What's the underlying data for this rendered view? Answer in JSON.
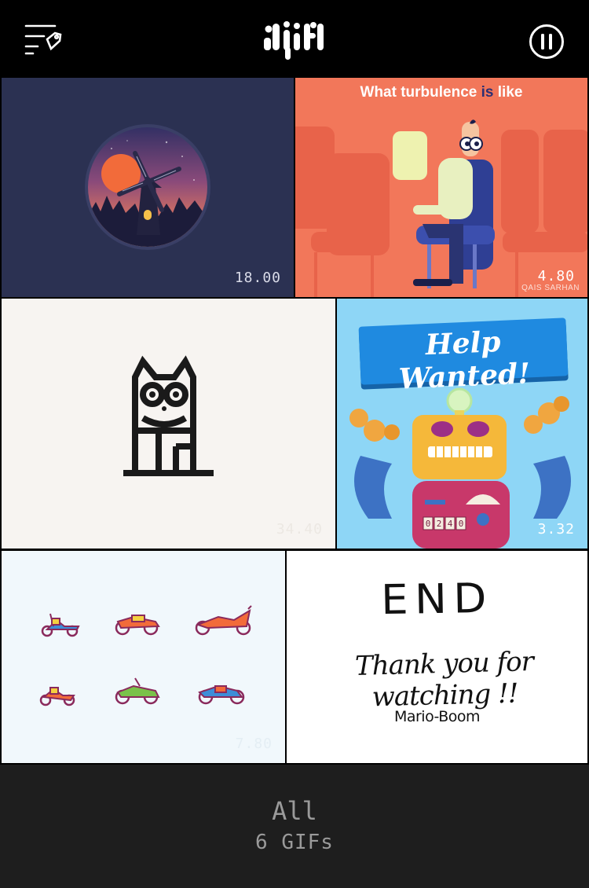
{
  "header": {
    "logo_text": "djif",
    "menu_icon": "menu-tag-icon",
    "pause_icon": "pause-circle-icon"
  },
  "gifs": [
    {
      "id": "windmill",
      "duration": "18.00",
      "duration_color": "#d9dbe8"
    },
    {
      "id": "turbulence",
      "title_pre": "What turbulence ",
      "title_hl": "is",
      "title_post": " like",
      "duration": "4.80",
      "credit": "QAIS SARHAN",
      "duration_color": "#ffffff"
    },
    {
      "id": "cat",
      "duration": "34.40",
      "duration_color": "#ece8e3"
    },
    {
      "id": "help-wanted",
      "banner": "Help Wanted!",
      "counter": [
        "0",
        "2",
        "4",
        "0"
      ],
      "duration": "3.32",
      "duration_color": "#ffffff"
    },
    {
      "id": "motorbikes",
      "duration": "7.80",
      "duration_color": "#e4eef4"
    },
    {
      "id": "end",
      "heading": "END",
      "message": "Thank you for watching !!",
      "author": "Mario-Boom"
    }
  ],
  "footer": {
    "category": "All",
    "count": "6 GIFs"
  }
}
